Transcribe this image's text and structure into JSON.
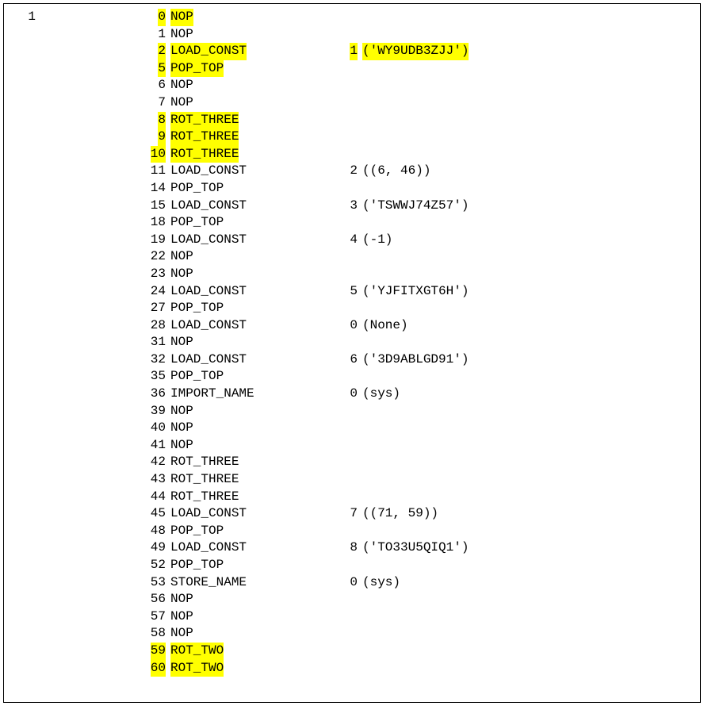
{
  "line_number": "1",
  "rows": [
    {
      "offset": "0",
      "opcode": "NOP",
      "argnum": "",
      "argval": "",
      "hl_offset": true,
      "hl_opcode": true,
      "hl_args": false
    },
    {
      "offset": "1",
      "opcode": "NOP",
      "argnum": "",
      "argval": "",
      "hl_offset": false,
      "hl_opcode": false,
      "hl_args": false
    },
    {
      "offset": "2",
      "opcode": "LOAD_CONST",
      "argnum": "1",
      "argval": "('WY9UDB3ZJJ')",
      "hl_offset": true,
      "hl_opcode": true,
      "hl_args": true
    },
    {
      "offset": "5",
      "opcode": "POP_TOP",
      "argnum": "",
      "argval": "",
      "hl_offset": true,
      "hl_opcode": true,
      "hl_args": false
    },
    {
      "offset": "6",
      "opcode": "NOP",
      "argnum": "",
      "argval": "",
      "hl_offset": false,
      "hl_opcode": false,
      "hl_args": false
    },
    {
      "offset": "7",
      "opcode": "NOP",
      "argnum": "",
      "argval": "",
      "hl_offset": false,
      "hl_opcode": false,
      "hl_args": false
    },
    {
      "offset": "8",
      "opcode": "ROT_THREE",
      "argnum": "",
      "argval": "",
      "hl_offset": true,
      "hl_opcode": true,
      "hl_args": false
    },
    {
      "offset": "9",
      "opcode": "ROT_THREE",
      "argnum": "",
      "argval": "",
      "hl_offset": true,
      "hl_opcode": true,
      "hl_args": false
    },
    {
      "offset": "10",
      "opcode": "ROT_THREE",
      "argnum": "",
      "argval": "",
      "hl_offset": true,
      "hl_opcode": true,
      "hl_args": false
    },
    {
      "offset": "11",
      "opcode": "LOAD_CONST",
      "argnum": "2",
      "argval": "((6, 46))",
      "hl_offset": false,
      "hl_opcode": false,
      "hl_args": false
    },
    {
      "offset": "14",
      "opcode": "POP_TOP",
      "argnum": "",
      "argval": "",
      "hl_offset": false,
      "hl_opcode": false,
      "hl_args": false
    },
    {
      "offset": "15",
      "opcode": "LOAD_CONST",
      "argnum": "3",
      "argval": "('TSWWJ74Z57')",
      "hl_offset": false,
      "hl_opcode": false,
      "hl_args": false
    },
    {
      "offset": "18",
      "opcode": "POP_TOP",
      "argnum": "",
      "argval": "",
      "hl_offset": false,
      "hl_opcode": false,
      "hl_args": false
    },
    {
      "offset": "19",
      "opcode": "LOAD_CONST",
      "argnum": "4",
      "argval": "(-1)",
      "hl_offset": false,
      "hl_opcode": false,
      "hl_args": false
    },
    {
      "offset": "22",
      "opcode": "NOP",
      "argnum": "",
      "argval": "",
      "hl_offset": false,
      "hl_opcode": false,
      "hl_args": false
    },
    {
      "offset": "23",
      "opcode": "NOP",
      "argnum": "",
      "argval": "",
      "hl_offset": false,
      "hl_opcode": false,
      "hl_args": false
    },
    {
      "offset": "24",
      "opcode": "LOAD_CONST",
      "argnum": "5",
      "argval": "('YJFITXGT6H')",
      "hl_offset": false,
      "hl_opcode": false,
      "hl_args": false
    },
    {
      "offset": "27",
      "opcode": "POP_TOP",
      "argnum": "",
      "argval": "",
      "hl_offset": false,
      "hl_opcode": false,
      "hl_args": false
    },
    {
      "offset": "28",
      "opcode": "LOAD_CONST",
      "argnum": "0",
      "argval": "(None)",
      "hl_offset": false,
      "hl_opcode": false,
      "hl_args": false
    },
    {
      "offset": "31",
      "opcode": "NOP",
      "argnum": "",
      "argval": "",
      "hl_offset": false,
      "hl_opcode": false,
      "hl_args": false
    },
    {
      "offset": "32",
      "opcode": "LOAD_CONST",
      "argnum": "6",
      "argval": "('3D9ABLGD91')",
      "hl_offset": false,
      "hl_opcode": false,
      "hl_args": false
    },
    {
      "offset": "35",
      "opcode": "POP_TOP",
      "argnum": "",
      "argval": "",
      "hl_offset": false,
      "hl_opcode": false,
      "hl_args": false
    },
    {
      "offset": "36",
      "opcode": "IMPORT_NAME",
      "argnum": "0",
      "argval": "(sys)",
      "hl_offset": false,
      "hl_opcode": false,
      "hl_args": false
    },
    {
      "offset": "39",
      "opcode": "NOP",
      "argnum": "",
      "argval": "",
      "hl_offset": false,
      "hl_opcode": false,
      "hl_args": false
    },
    {
      "offset": "40",
      "opcode": "NOP",
      "argnum": "",
      "argval": "",
      "hl_offset": false,
      "hl_opcode": false,
      "hl_args": false
    },
    {
      "offset": "41",
      "opcode": "NOP",
      "argnum": "",
      "argval": "",
      "hl_offset": false,
      "hl_opcode": false,
      "hl_args": false
    },
    {
      "offset": "42",
      "opcode": "ROT_THREE",
      "argnum": "",
      "argval": "",
      "hl_offset": false,
      "hl_opcode": false,
      "hl_args": false
    },
    {
      "offset": "43",
      "opcode": "ROT_THREE",
      "argnum": "",
      "argval": "",
      "hl_offset": false,
      "hl_opcode": false,
      "hl_args": false
    },
    {
      "offset": "44",
      "opcode": "ROT_THREE",
      "argnum": "",
      "argval": "",
      "hl_offset": false,
      "hl_opcode": false,
      "hl_args": false
    },
    {
      "offset": "45",
      "opcode": "LOAD_CONST",
      "argnum": "7",
      "argval": "((71, 59))",
      "hl_offset": false,
      "hl_opcode": false,
      "hl_args": false
    },
    {
      "offset": "48",
      "opcode": "POP_TOP",
      "argnum": "",
      "argval": "",
      "hl_offset": false,
      "hl_opcode": false,
      "hl_args": false
    },
    {
      "offset": "49",
      "opcode": "LOAD_CONST",
      "argnum": "8",
      "argval": "('TO33U5QIQ1')",
      "hl_offset": false,
      "hl_opcode": false,
      "hl_args": false
    },
    {
      "offset": "52",
      "opcode": "POP_TOP",
      "argnum": "",
      "argval": "",
      "hl_offset": false,
      "hl_opcode": false,
      "hl_args": false
    },
    {
      "offset": "53",
      "opcode": "STORE_NAME",
      "argnum": "0",
      "argval": "(sys)",
      "hl_offset": false,
      "hl_opcode": false,
      "hl_args": false
    },
    {
      "offset": "56",
      "opcode": "NOP",
      "argnum": "",
      "argval": "",
      "hl_offset": false,
      "hl_opcode": false,
      "hl_args": false
    },
    {
      "offset": "57",
      "opcode": "NOP",
      "argnum": "",
      "argval": "",
      "hl_offset": false,
      "hl_opcode": false,
      "hl_args": false
    },
    {
      "offset": "58",
      "opcode": "NOP",
      "argnum": "",
      "argval": "",
      "hl_offset": false,
      "hl_opcode": false,
      "hl_args": false
    },
    {
      "offset": "59",
      "opcode": "ROT_TWO",
      "argnum": "",
      "argval": "",
      "hl_offset": true,
      "hl_opcode": true,
      "hl_args": false
    },
    {
      "offset": "60",
      "opcode": "ROT_TWO",
      "argnum": "",
      "argval": "",
      "hl_offset": true,
      "hl_opcode": true,
      "hl_args": false
    }
  ]
}
